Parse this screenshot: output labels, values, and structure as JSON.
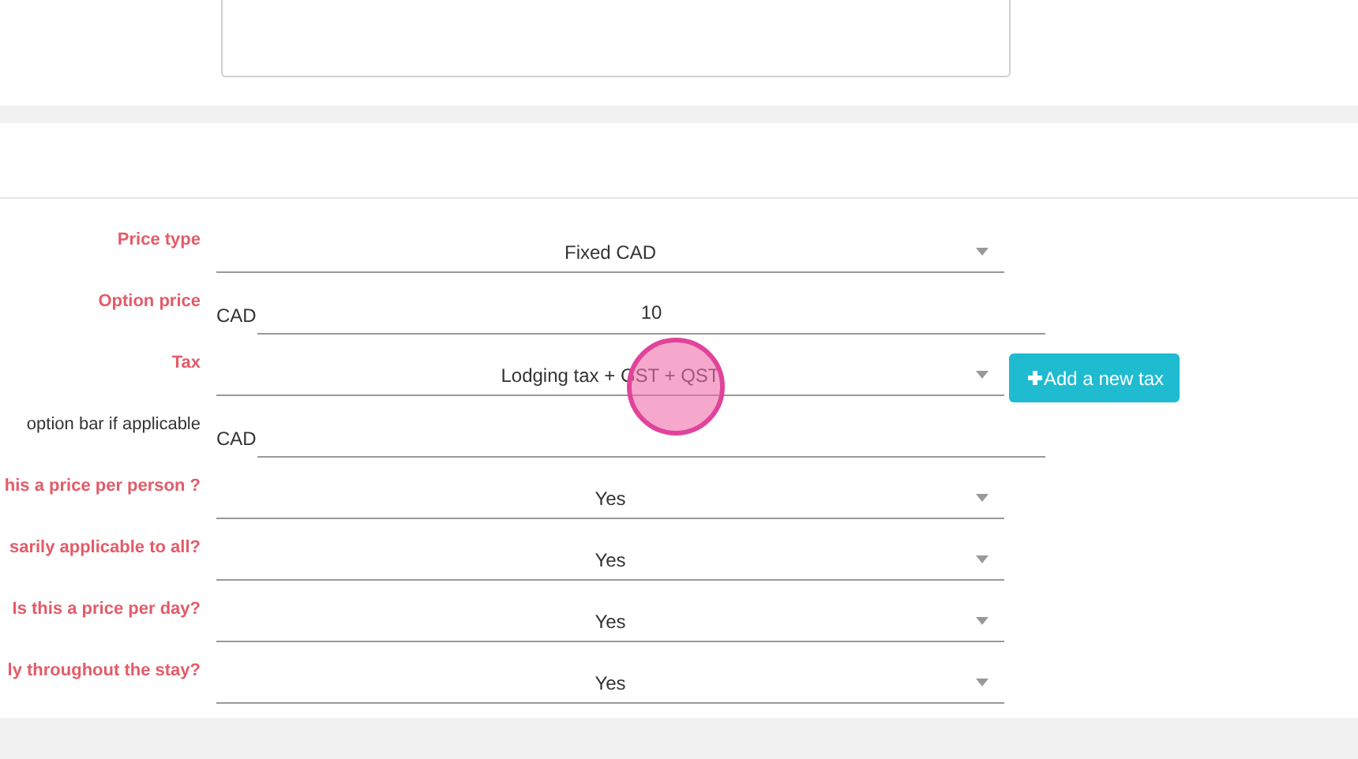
{
  "rows": [
    {
      "label": "Price type",
      "required": true,
      "kind": "select",
      "value": "Fixed CAD"
    },
    {
      "label": "Option price",
      "required": true,
      "kind": "currency",
      "prefix": "CAD",
      "value": "10"
    },
    {
      "label": "Tax",
      "required": true,
      "kind": "select",
      "value": "Lodging tax + GST + QST",
      "button": "Add a new tax"
    },
    {
      "label": "option bar if applicable",
      "required": false,
      "kind": "currency",
      "prefix": "CAD"
    },
    {
      "label": "his a price per person ?",
      "required": true,
      "kind": "select",
      "value": "Yes"
    },
    {
      "label": "sarily applicable to all?",
      "required": true,
      "kind": "select",
      "value": "Yes"
    },
    {
      "label": "Is this a price per day?",
      "required": true,
      "kind": "select",
      "value": "Yes"
    },
    {
      "label": "ly throughout the stay?",
      "required": true,
      "kind": "select",
      "value": "Yes"
    }
  ],
  "click_marker": true
}
